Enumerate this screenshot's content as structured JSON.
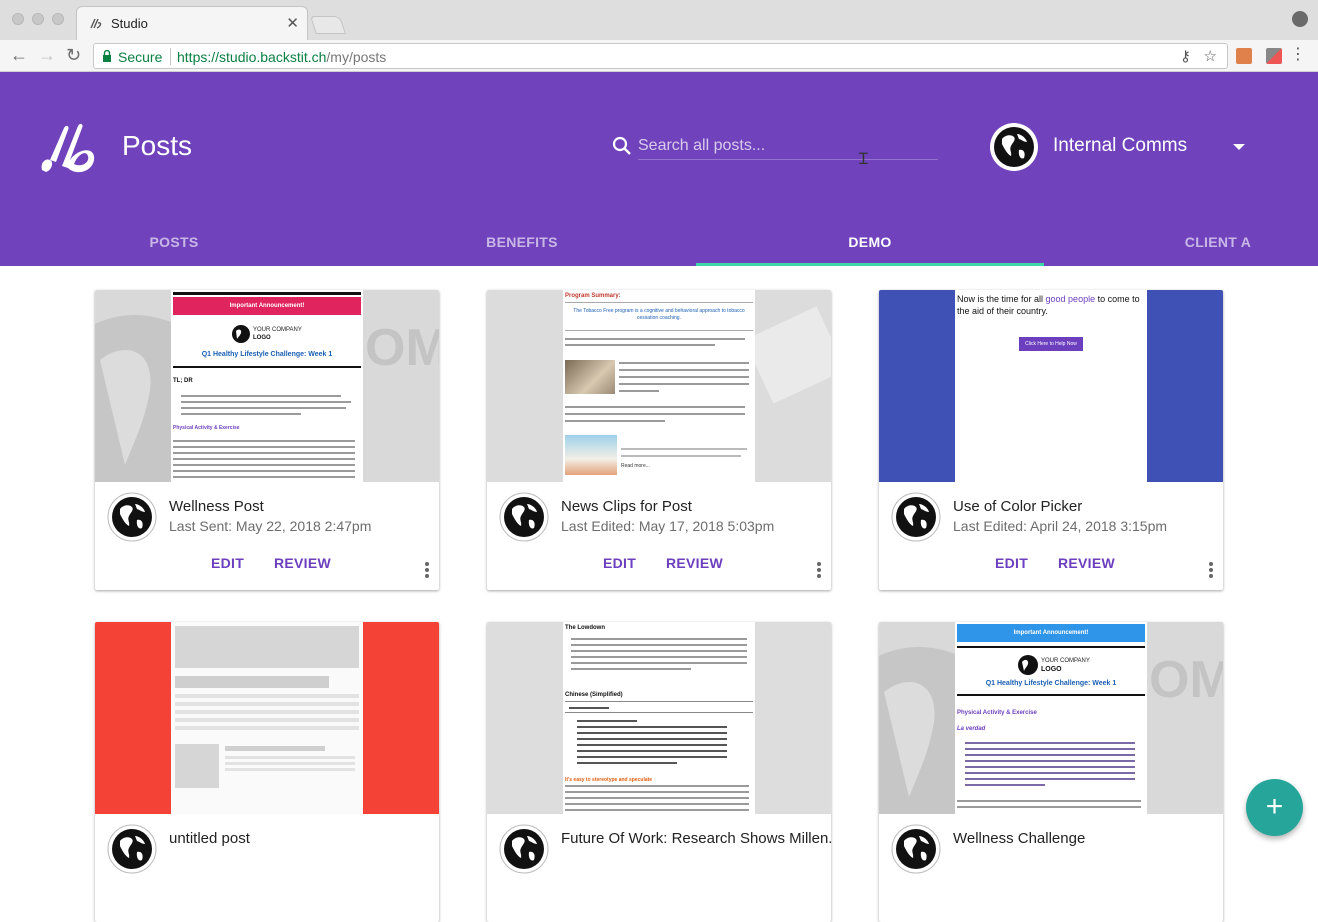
{
  "browser": {
    "tab_title": "Studio",
    "secure_label": "Secure",
    "url_host": "https://studio.backstit.ch",
    "url_path": "/my/posts"
  },
  "header": {
    "title": "Posts",
    "search_placeholder": "Search all posts...",
    "account_name": "Internal Comms",
    "brand_color": "#7043bd"
  },
  "tabs": [
    {
      "label": "POSTS",
      "active": false
    },
    {
      "label": "BENEFITS",
      "active": false
    },
    {
      "label": "DEMO",
      "active": true
    },
    {
      "label": "CLIENT A",
      "active": false
    }
  ],
  "actions": {
    "edit": "EDIT",
    "review": "REVIEW"
  },
  "cards": [
    {
      "title": "Wellness Post",
      "meta": "Last Sent: May 22, 2018 2:47pm",
      "thumb": {
        "banner": "Important Announcement!",
        "company": "YOUR COMPANY",
        "logo": "LOGO",
        "heading": "Q1 Healthy Lifestyle Challenge: Week 1",
        "tldr": "TL; DR",
        "section": "Physical Activity & Exercise"
      }
    },
    {
      "title": "News Clips for Post",
      "meta": "Last Edited: May 17, 2018 5:03pm",
      "thumb": {
        "summary": "Program Summary:",
        "intro": "The Tobacco Free program is a cognitive and behavioral approach to tobacco cessation coaching.",
        "read_more": "Read more..."
      }
    },
    {
      "title": "Use of Color Picker",
      "meta": "Last Edited: April 24, 2018 3:15pm",
      "thumb": {
        "text_a": "Now is the time for all ",
        "text_b": "good people",
        "text_c": " to come to the aid of their country.",
        "button": "Click Here to Help Now"
      }
    },
    {
      "title": "untitled post",
      "meta": "",
      "thumb": {}
    },
    {
      "title": "Future Of Work: Research Shows Millen...",
      "meta": "",
      "thumb": {
        "heading": "The Lowdown",
        "subheading": "Chinese (Simplified)",
        "highlight": "It's easy to stereotype and speculate"
      }
    },
    {
      "title": "Wellness Challenge",
      "meta": "",
      "thumb": {
        "banner": "Important Announcement!",
        "company": "YOUR COMPANY",
        "logo": "LOGO",
        "heading": "Q1 Healthy Lifestyle Challenge: Week 1",
        "section": "Physical Activity & Exercise",
        "subsection": "La verdad"
      }
    }
  ],
  "fab": {
    "label": "+"
  }
}
